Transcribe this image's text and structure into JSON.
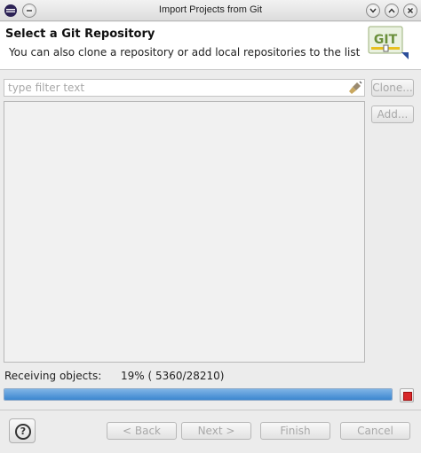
{
  "window": {
    "title": "Import Projects from Git",
    "controls": [
      "chevron-down-icon",
      "chevron-up-icon",
      "close-icon"
    ]
  },
  "header": {
    "title": "Select a Git Repository",
    "description": "You can also clone a repository or add local repositories to the list",
    "logo_text": "GIT"
  },
  "filter": {
    "placeholder": "type filter text"
  },
  "side_buttons": {
    "clone_label": "Clone...",
    "add_label": "Add..."
  },
  "progress": {
    "label": "Receiving objects:",
    "value_text": "19% ( 5360/28210)",
    "percent": 19
  },
  "footer": {
    "back_label": "< Back",
    "next_label": "Next >",
    "finish_label": "Finish",
    "cancel_label": "Cancel"
  },
  "colors": {
    "progress_fill": "#3b86cf",
    "stop": "#d8282a",
    "disabled_text": "#a8a8a8"
  }
}
